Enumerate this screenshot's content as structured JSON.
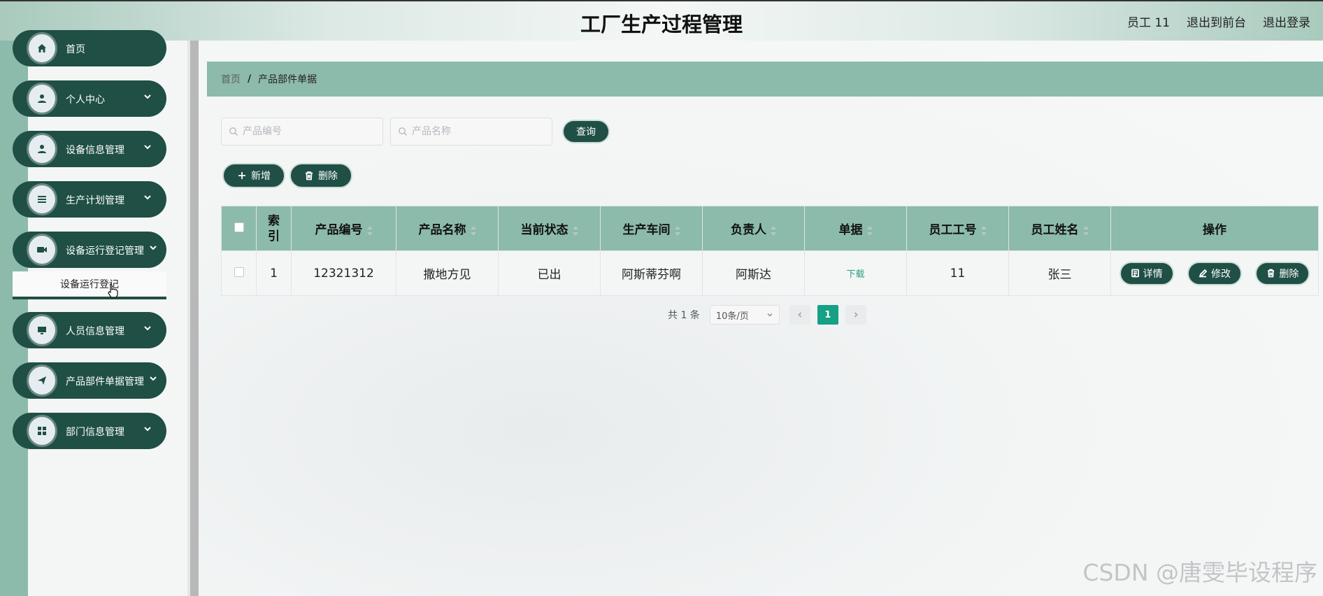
{
  "header": {
    "title": "工厂生产过程管理",
    "user_label": "员工 11",
    "front_link": "退出到前台",
    "logout_link": "退出登录"
  },
  "sidebar": {
    "items": [
      {
        "label": "首页",
        "icon": "home-icon"
      },
      {
        "label": "个人中心",
        "icon": "user-icon"
      },
      {
        "label": "设备信息管理",
        "icon": "user-icon"
      },
      {
        "label": "生产计划管理",
        "icon": "list-icon"
      },
      {
        "label": "设备运行登记管理",
        "icon": "video-icon"
      },
      {
        "label": "人员信息管理",
        "icon": "monitor-icon"
      },
      {
        "label": "产品部件单据管理",
        "icon": "send-icon"
      },
      {
        "label": "部门信息管理",
        "icon": "grid-icon"
      }
    ],
    "submenu_active": "设备运行登记"
  },
  "breadcrumb": {
    "home": "首页",
    "separator": "/",
    "current": "产品部件单据"
  },
  "search": {
    "product_no_placeholder": "产品编号",
    "product_name_placeholder": "产品名称",
    "query_label": "查询"
  },
  "actions": {
    "add_label": "新增",
    "delete_label": "删除"
  },
  "table": {
    "headers": {
      "index": "索引",
      "product_no": "产品编号",
      "product_name": "产品名称",
      "status": "当前状态",
      "workshop": "生产车间",
      "manager": "负责人",
      "document": "单据",
      "employee_no": "员工工号",
      "employee_name": "员工姓名",
      "operation": "操作"
    },
    "rows": [
      {
        "index": "1",
        "product_no": "12321312",
        "product_name": "撒地方见",
        "status": "已出",
        "workshop": "阿斯蒂芬啊",
        "manager": "阿斯达",
        "document": "下载",
        "employee_no": "11",
        "employee_name": "张三"
      }
    ],
    "op_labels": {
      "detail": "详情",
      "edit": "修改",
      "delete": "删除"
    }
  },
  "pagination": {
    "total_text": "共 1 条",
    "page_size": "10条/页",
    "current_page": "1"
  },
  "watermark": "CSDN @唐雯毕设程序",
  "colors": {
    "primary": "#1f4f45",
    "accent": "#8cbaab",
    "active_page": "#16a085"
  }
}
